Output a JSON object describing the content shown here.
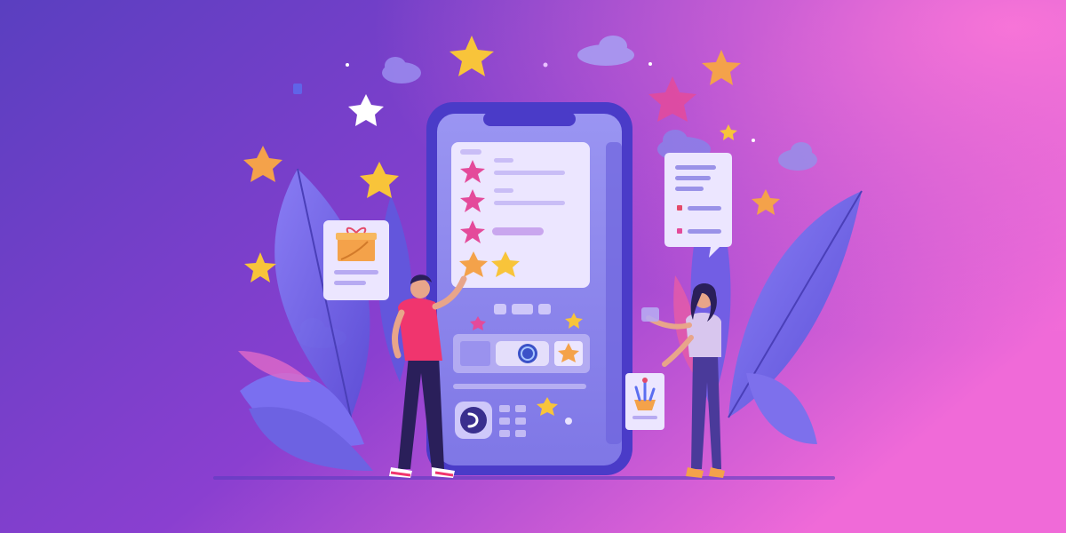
{
  "scene": {
    "description_type": "illustration",
    "colors": {
      "bg_left": "#5a3fc0",
      "bg_mid": "#8a3fd0",
      "bg_right": "#f06ad8",
      "phone_body": "#4a3bc8",
      "phone_screen": "#8e88ee",
      "card": "#ece6ff",
      "star_yellow": "#f8c43a",
      "star_orange": "#f4a24a",
      "star_pink": "#e44a9a",
      "star_white": "#ffffff",
      "leaf": "#7b6ef2",
      "man_shirt": "#f0356e",
      "man_pants": "#2a1f5a",
      "woman_top": "#d8c6ee",
      "woman_pants": "#4a3a9a"
    },
    "icons": {
      "rating_stars": [
        "star-icon",
        "star-icon",
        "star-icon",
        "star-icon",
        "star-icon"
      ],
      "gift": "gift-icon",
      "plant": "potted-plant-icon",
      "play": "play-icon",
      "globe": "globe-icon"
    },
    "rating": {
      "filled_stars": 5,
      "max_stars": 5
    }
  }
}
